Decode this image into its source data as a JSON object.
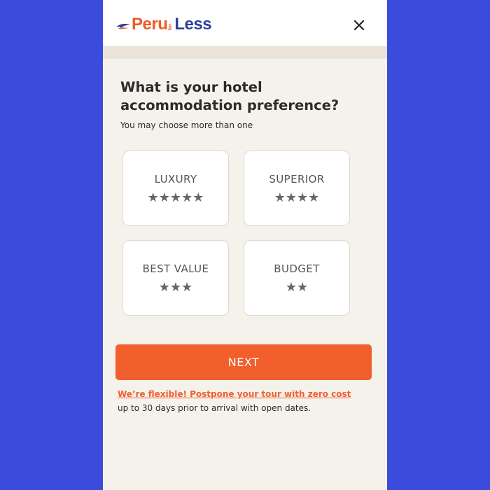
{
  "header": {
    "logo": {
      "part1": "Peru",
      "part2": "for",
      "part3": "Less"
    },
    "close_icon": "close-icon"
  },
  "question": {
    "title": "What is your hotel\naccommodation preference?",
    "hint": "You may choose more than one"
  },
  "options": [
    {
      "label": "LUXURY",
      "stars": 5,
      "stars_text": "★★★★★"
    },
    {
      "label": "SUPERIOR",
      "stars": 4,
      "stars_text": "★★★★"
    },
    {
      "label": "BEST VALUE",
      "stars": 3,
      "stars_text": "★★★"
    },
    {
      "label": "BUDGET",
      "stars": 2,
      "stars_text": "★★"
    }
  ],
  "next_button": {
    "label": "NEXT"
  },
  "flexible": {
    "link": "We’re flexible! Postpone your tour with zero cost",
    "text": "up to 30 days prior to arrival with open dates."
  },
  "colors": {
    "background": "#3b4bdb",
    "accent": "#f05f2c",
    "brand_blue": "#2e3f9c",
    "panel": "#f5f2ec"
  }
}
